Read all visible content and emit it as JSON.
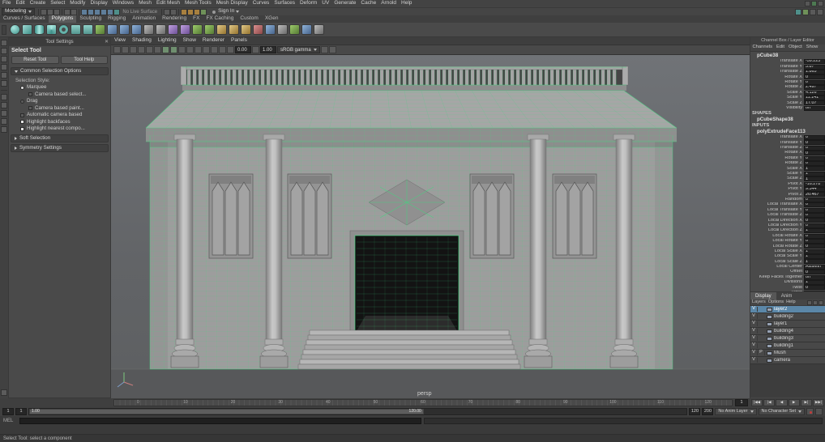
{
  "colors": {
    "wireframe_green": "#3fd87e",
    "selection_blue": "#5b87a8",
    "ui_bg": "#444444",
    "field_bg": "#232323",
    "viewport_bg_top": "#707377",
    "viewport_bg_bottom": "#5d5f61",
    "building_gray": "#9d9d9d"
  },
  "menubar": {
    "items": [
      "File",
      "Edit",
      "Create",
      "Select",
      "Modify",
      "Display",
      "Windows",
      "Mesh",
      "Edit Mesh",
      "Mesh Tools",
      "Mesh Display",
      "Curves",
      "Surfaces",
      "Deform",
      "UV",
      "Generate",
      "Cache",
      "Arnold",
      "Help"
    ]
  },
  "statusline": {
    "workspace": "Modeling",
    "no_live_surface": "No Live Surface",
    "sign_in": "Sign In"
  },
  "shelf": {
    "tabs": [
      {
        "label": "Curves / Surfaces"
      },
      {
        "label": "Polygons",
        "cls": "sel"
      },
      {
        "label": "Sculpting"
      },
      {
        "label": "Rigging"
      },
      {
        "label": "Animation"
      },
      {
        "label": "Rendering"
      },
      {
        "label": "FX"
      },
      {
        "label": "FX Caching"
      },
      {
        "label": "Custom"
      },
      {
        "label": "XGen"
      }
    ]
  },
  "tool_settings": {
    "title": "Tool Settings",
    "tool_name": "Select Tool",
    "reset_label": "Reset Tool",
    "help_label": "Tool Help",
    "common_header": "Common Selection Options",
    "selection_style_label": "Selection Style:",
    "options": [
      {
        "label": "Marquee",
        "cls": "radio on"
      },
      {
        "label": "Camera based select...",
        "cls": "check indent"
      },
      {
        "label": "Drag",
        "cls": "radio"
      },
      {
        "label": "Camera based paint...",
        "cls": "check indent"
      },
      {
        "label": "Automatic camera based",
        "cls": "check"
      },
      {
        "label": "Highlight backfaces",
        "cls": "check on"
      },
      {
        "label": "Highlight nearest compo...",
        "cls": "check on"
      }
    ],
    "soft_header": "Soft Selection",
    "symmetry_header": "Symmetry Settings"
  },
  "viewport": {
    "menus": [
      {
        "label": "View"
      },
      {
        "label": "Shading"
      },
      {
        "label": "Lighting"
      },
      {
        "label": "Show"
      },
      {
        "label": "Renderer"
      },
      {
        "label": "Panels"
      }
    ],
    "exposure": "0.00",
    "gamma": "1.00",
    "view_transform": "sRGB gamma",
    "camera": "persp"
  },
  "channel_box": {
    "title": "Channel Box / Layer Editor",
    "tabs": [
      {
        "label": "Channels"
      },
      {
        "label": "Edit"
      },
      {
        "label": "Object"
      },
      {
        "label": "Show"
      }
    ],
    "node": "pCube38",
    "attrs": [
      {
        "label": "Translate X",
        "value": "-59.223"
      },
      {
        "label": "Translate Y",
        "value": "5.87"
      },
      {
        "label": "Translate Z",
        "value": "1.865"
      },
      {
        "label": "Rotate X",
        "value": "0"
      },
      {
        "label": "Rotate Y",
        "value": "0"
      },
      {
        "label": "Rotate Z",
        "value": "2.497"
      },
      {
        "label": "Scale X",
        "value": "4.126"
      },
      {
        "label": "Scale Y",
        "value": "11.141"
      },
      {
        "label": "Scale Z",
        "value": "17.07"
      },
      {
        "label": "Visibility",
        "value": "on"
      }
    ],
    "shapes_header": "SHAPES",
    "shape_node": "pCubeShape38",
    "inputs_header": "INPUTS",
    "input_node": "polyExtrudeFace113",
    "input_attrs": [
      {
        "label": "Translate X",
        "value": "0"
      },
      {
        "label": "Translate Y",
        "value": "0"
      },
      {
        "label": "Translate Z",
        "value": "0"
      },
      {
        "label": "Rotate X",
        "value": "0"
      },
      {
        "label": "Rotate Y",
        "value": "0"
      },
      {
        "label": "Rotate Z",
        "value": "0"
      },
      {
        "label": "Scale X",
        "value": "1"
      },
      {
        "label": "Scale Y",
        "value": "1"
      },
      {
        "label": "Scale Z",
        "value": "1"
      },
      {
        "label": "Pivot X",
        "value": "-16.278"
      },
      {
        "label": "Pivot Y",
        "value": "9.344"
      },
      {
        "label": "Pivot Z",
        "value": "20.467"
      },
      {
        "label": "Random",
        "value": "0"
      },
      {
        "label": "Local Translate X",
        "value": "0"
      },
      {
        "label": "Local Translate Y",
        "value": "0"
      },
      {
        "label": "Local Translate Z",
        "value": "0"
      },
      {
        "label": "Local Direction X",
        "value": "0"
      },
      {
        "label": "Local Direction Y",
        "value": "0"
      },
      {
        "label": "Local Direction Z",
        "value": "1"
      },
      {
        "label": "Local Rotate X",
        "value": "0"
      },
      {
        "label": "Local Rotate Y",
        "value": "0"
      },
      {
        "label": "Local Rotate Z",
        "value": "0"
      },
      {
        "label": "Local Scale X",
        "value": "1"
      },
      {
        "label": "Local Scale Y",
        "value": "1"
      },
      {
        "label": "Local Scale Z",
        "value": "1"
      },
      {
        "label": "Local Center",
        "value": "AxisMin"
      },
      {
        "label": "Offset",
        "value": "0"
      },
      {
        "label": "Keep Faces Together",
        "value": "on"
      },
      {
        "label": "Divisions",
        "value": "1"
      },
      {
        "label": "Twist",
        "value": "0"
      },
      {
        "label": "Taper",
        "value": "1"
      }
    ]
  },
  "layer_editor": {
    "tabs": [
      {
        "label": "Display",
        "cls": "sel"
      },
      {
        "label": "Anim"
      }
    ],
    "menus": [
      {
        "label": "Layers"
      },
      {
        "label": "Options"
      },
      {
        "label": "Help"
      }
    ],
    "layers": [
      {
        "v": "V",
        "p": "",
        "name": "layer2",
        "cls": "sel"
      },
      {
        "v": "V",
        "p": "",
        "name": "building2"
      },
      {
        "v": "V",
        "p": "",
        "name": "layer1"
      },
      {
        "v": "V",
        "p": "",
        "name": "building4"
      },
      {
        "v": "V",
        "p": "",
        "name": "building3"
      },
      {
        "v": "V",
        "p": "",
        "name": "building1"
      },
      {
        "v": "V",
        "p": "P",
        "name": "Mush"
      },
      {
        "v": "V",
        "p": "",
        "name": "camera"
      }
    ]
  },
  "timeline": {
    "ticks": [
      "0",
      "10",
      "20",
      "30",
      "40",
      "50",
      "60",
      "70",
      "80",
      "90",
      "100",
      "110",
      "120"
    ]
  },
  "playback": {
    "buttons": [
      {
        "glyph": "|◀◀",
        "name": "go-to-start"
      },
      {
        "glyph": "|◀",
        "name": "step-back-frame"
      },
      {
        "glyph": "◀",
        "name": "play-backwards"
      },
      {
        "glyph": "▶",
        "name": "play-forwards"
      },
      {
        "glyph": "▶|",
        "name": "step-forward-frame"
      },
      {
        "glyph": "▶▶|",
        "name": "go-to-end"
      }
    ]
  },
  "range": {
    "current_frame": "1",
    "start": "1",
    "play_start": "1",
    "handle_start": "1.00",
    "handle_end": "120.00",
    "play_end": "120",
    "end": "200",
    "anim_layer": "No Anim Layer",
    "character_set": "No Character Set"
  },
  "command": {
    "label": "MEL"
  },
  "help": {
    "text": "Select Tool: select a component"
  }
}
